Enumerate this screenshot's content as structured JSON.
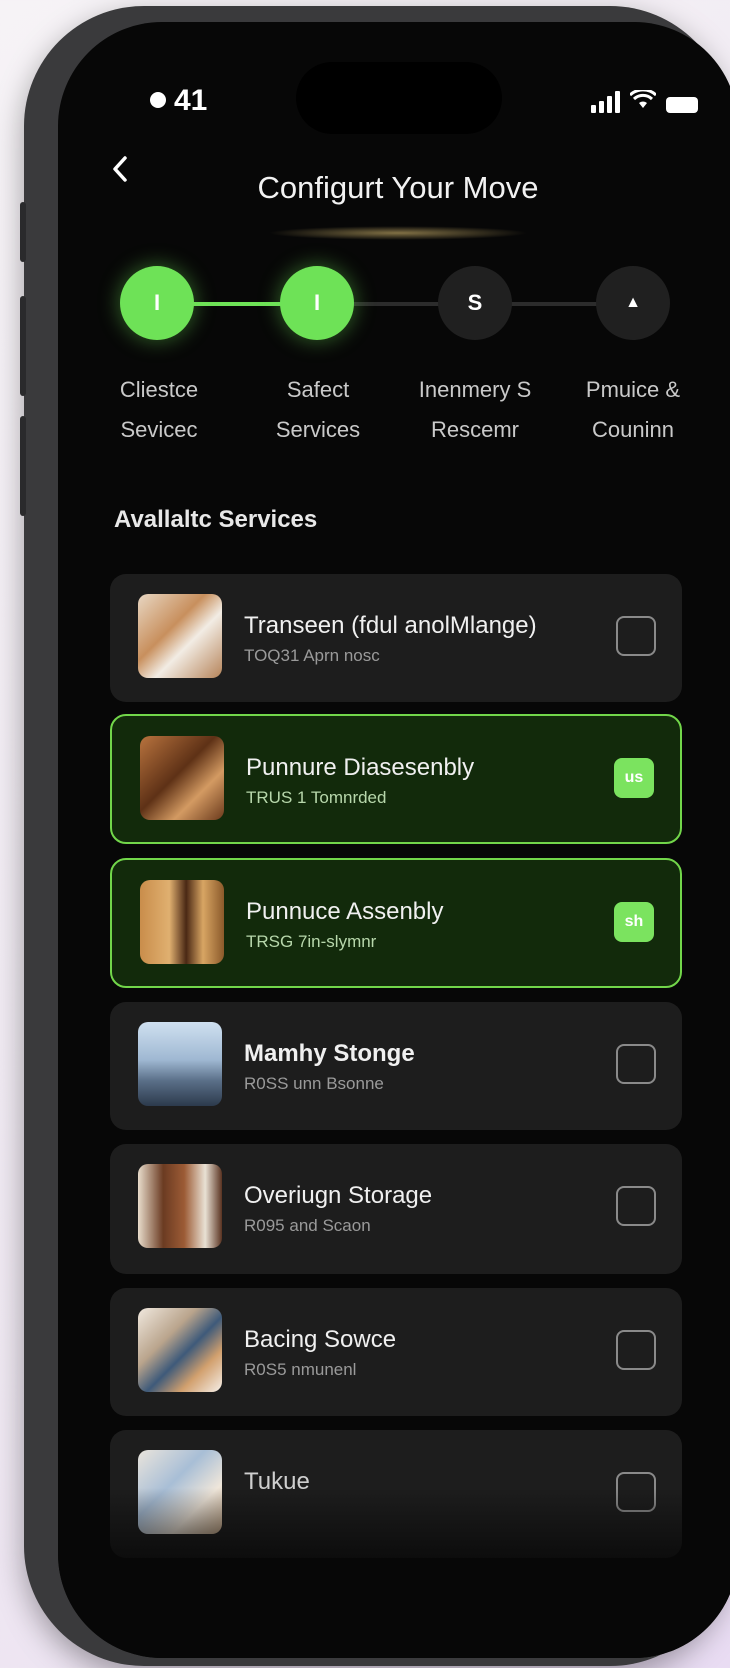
{
  "status_bar": {
    "time": "41"
  },
  "header": {
    "title": "Configurt Your Move"
  },
  "stepper": {
    "steps": [
      {
        "icon_text": "I",
        "label_line1": "Cliestce",
        "label_line2": "Sevicec",
        "state": "done"
      },
      {
        "icon_text": "I",
        "label_line1": "Safect",
        "label_line2": "Services",
        "state": "done"
      },
      {
        "icon_text": "S",
        "label_line1": "Inenmery S",
        "label_line2": "Rescemr",
        "state": "todo"
      },
      {
        "icon_text": "▲",
        "label_line1": "Pmuice &",
        "label_line2": "Couninn",
        "state": "todo"
      }
    ]
  },
  "section": {
    "title": "Avallaltc Services"
  },
  "services": [
    {
      "name": "Transeen (fdul anolMlange)",
      "sub": "TOQ31 Aprn nosc",
      "checked": false,
      "check_text": ""
    },
    {
      "name": "Punnure Diasesenbly",
      "sub": "TRUS 1 Tomnrded",
      "checked": true,
      "check_text": "us"
    },
    {
      "name": "Punnuce Assenbly",
      "sub": "TRSG 7in-slymnr",
      "checked": true,
      "check_text": "sh"
    },
    {
      "name": "Mamhy Stonge",
      "sub": "R0SS unn Bsonne",
      "checked": false,
      "check_text": ""
    },
    {
      "name": "Overiugn Storage",
      "sub": "R095 and Scaon",
      "checked": false,
      "check_text": ""
    },
    {
      "name": "Bacing Sowce",
      "sub": "R0S5 nmunenl",
      "checked": false,
      "check_text": ""
    },
    {
      "name": "Tukue",
      "sub": "",
      "checked": false,
      "check_text": ""
    }
  ],
  "colors": {
    "accent": "#6ee257",
    "selected_bg": "#122a0b",
    "card_bg": "#1d1d1d",
    "screen_bg": "#070707"
  }
}
